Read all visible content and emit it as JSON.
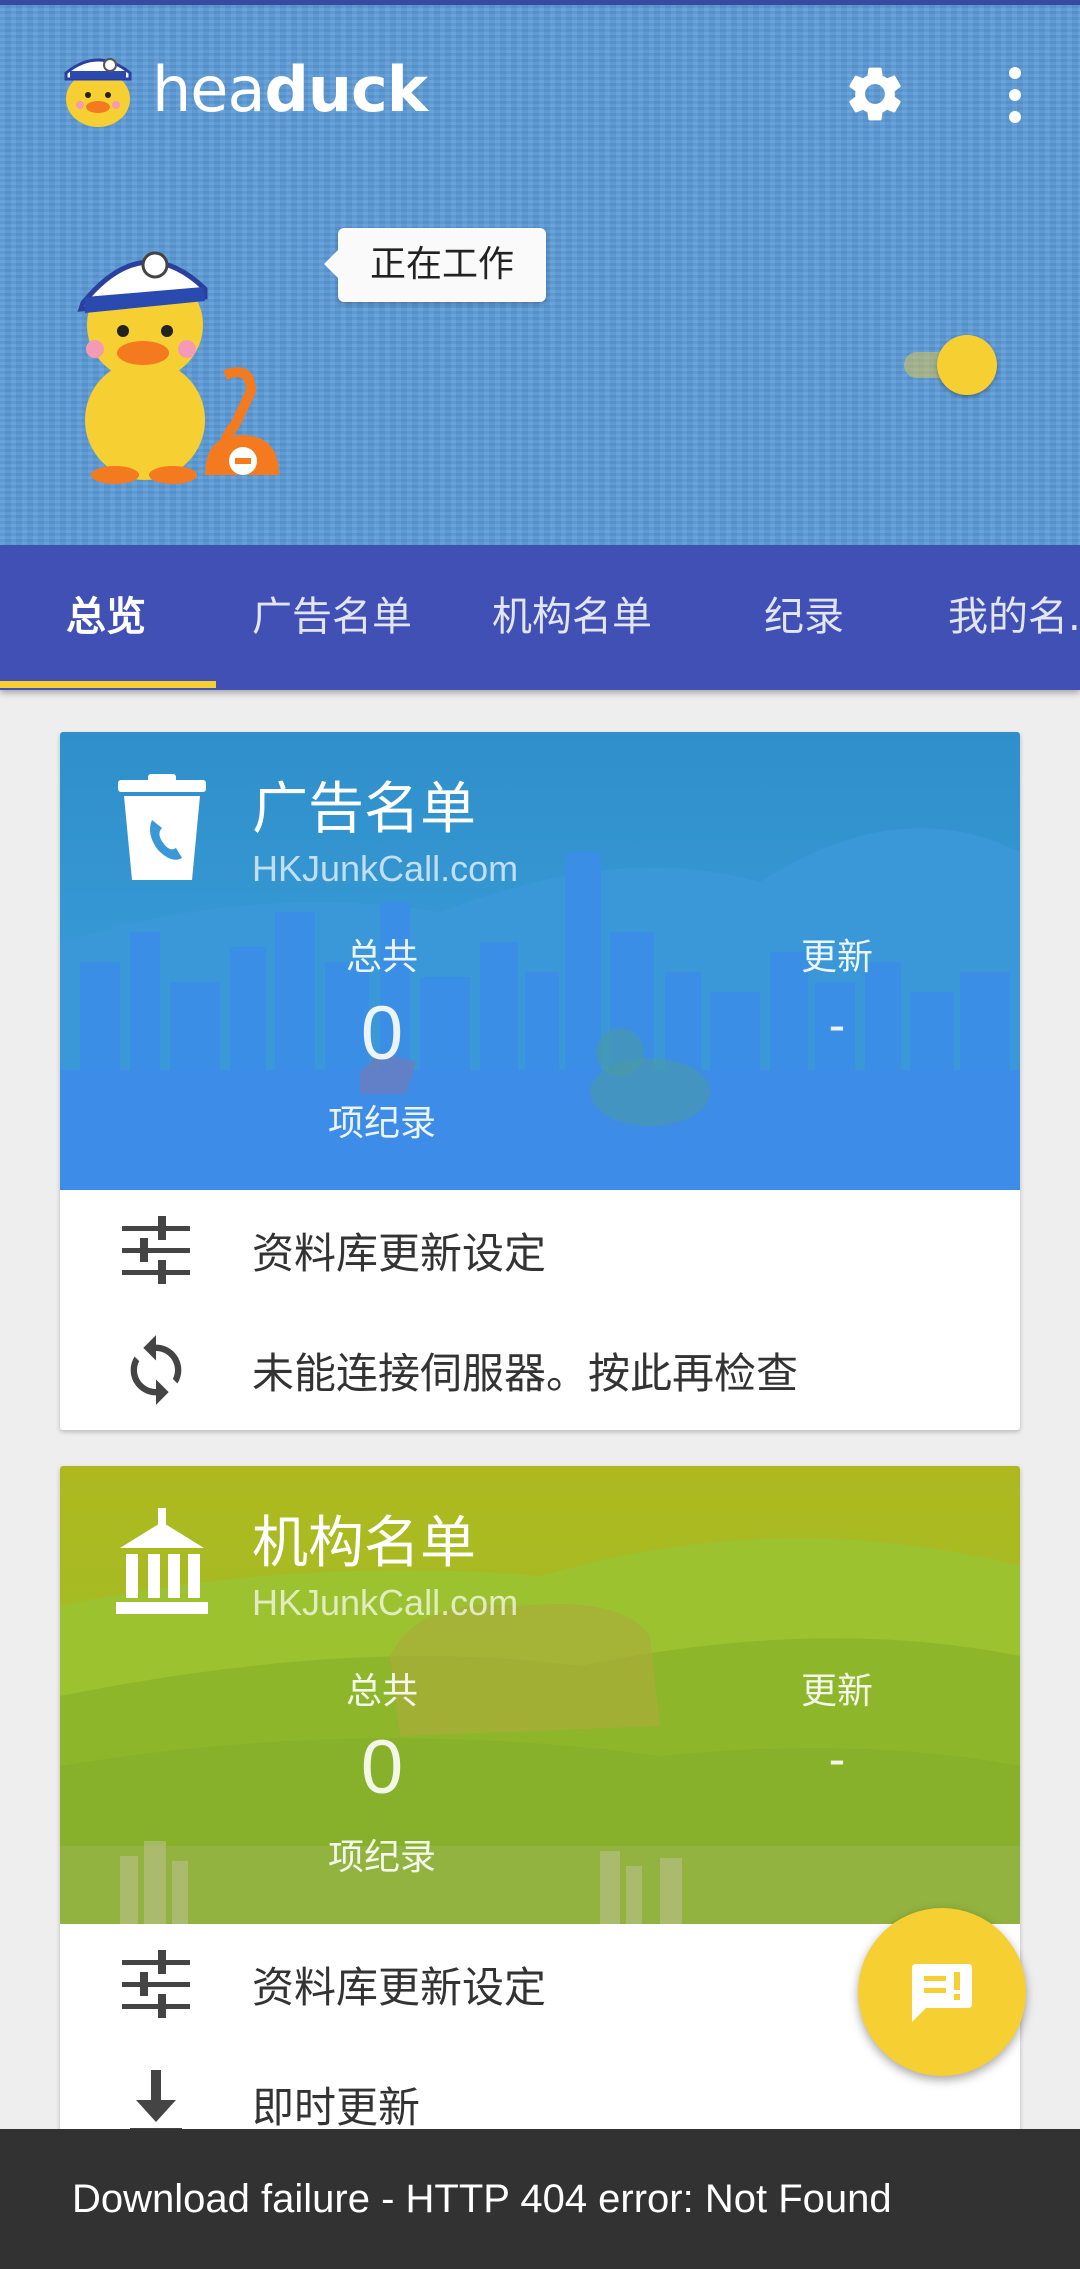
{
  "app": {
    "title_light": "hea",
    "title_bold": "duck",
    "status_text": "正在工作",
    "colors": {
      "header": "#5b9ad6",
      "tabbar": "#4150b4",
      "accent": "#f6cf32"
    }
  },
  "toolbar": {
    "settings_icon": "gear-icon",
    "menu_icon": "more-vert-icon"
  },
  "protection_toggle": {
    "on": true
  },
  "tabs": [
    {
      "label": "总览",
      "active": true
    },
    {
      "label": "广告名单",
      "active": false
    },
    {
      "label": "机构名单",
      "active": false
    },
    {
      "label": "纪录",
      "active": false
    },
    {
      "label": "我的名...",
      "active": false
    }
  ],
  "cards": [
    {
      "title": "广告名单",
      "source": "HKJunkCall.com",
      "total_label": "总共",
      "total_value": "0",
      "total_unit": "项纪录",
      "update_label": "更新",
      "update_value": "-",
      "icon": "trash-phone-icon",
      "actions": [
        {
          "label": "资料库更新设定",
          "icon": "tune-sliders-icon"
        },
        {
          "label": "未能连接伺服器。按此再检查",
          "icon": "refresh-icon"
        }
      ]
    },
    {
      "title": "机构名单",
      "source": "HKJunkCall.com",
      "total_label": "总共",
      "total_value": "0",
      "total_unit": "项纪录",
      "update_label": "更新",
      "update_value": "-",
      "icon": "institution-icon",
      "actions": [
        {
          "label": "资料库更新设定",
          "icon": "tune-sliders-icon"
        },
        {
          "label": "即时更新",
          "icon": "download-icon"
        }
      ]
    }
  ],
  "fab": {
    "icon": "feedback-icon"
  },
  "snackbar": {
    "message": "Download failure - HTTP 404 error: Not Found"
  }
}
